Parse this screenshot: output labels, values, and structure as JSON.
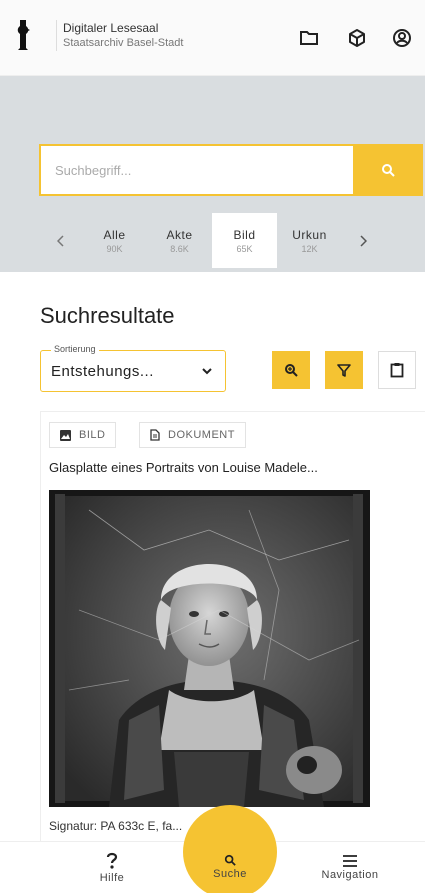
{
  "header": {
    "title": "Digitaler Lesesaal",
    "subtitle": "Staatsarchiv Basel-Stadt",
    "icons": [
      "folder-icon",
      "cube-icon",
      "user-circle-icon"
    ]
  },
  "search": {
    "placeholder": "Suchbegriff...",
    "value": "",
    "button_icon": "search-icon"
  },
  "tabs": [
    {
      "label": "Alle",
      "count": "90K",
      "active": false
    },
    {
      "label": "Akte",
      "count": "8.6K",
      "active": false
    },
    {
      "label": "Bild",
      "count": "65K",
      "active": true
    },
    {
      "label": "Urkun",
      "count": "12K",
      "active": false
    }
  ],
  "results": {
    "title": "Suchresultate",
    "sort_label": "Sortierung",
    "sort_value": "Entstehungs..."
  },
  "card": {
    "chip_image": "BILD",
    "chip_document": "DOKUMENT",
    "title": "Glasplatte eines Portraits von Louise Madele...",
    "signatur_label": "Signatur:",
    "signatur_value": "PA 633c E, fa..."
  },
  "bottom_nav": {
    "help": "Hilfe",
    "search": "Suche",
    "navigation": "Navigation"
  },
  "colors": {
    "accent": "#f5c332",
    "band": "#d9dde0"
  }
}
